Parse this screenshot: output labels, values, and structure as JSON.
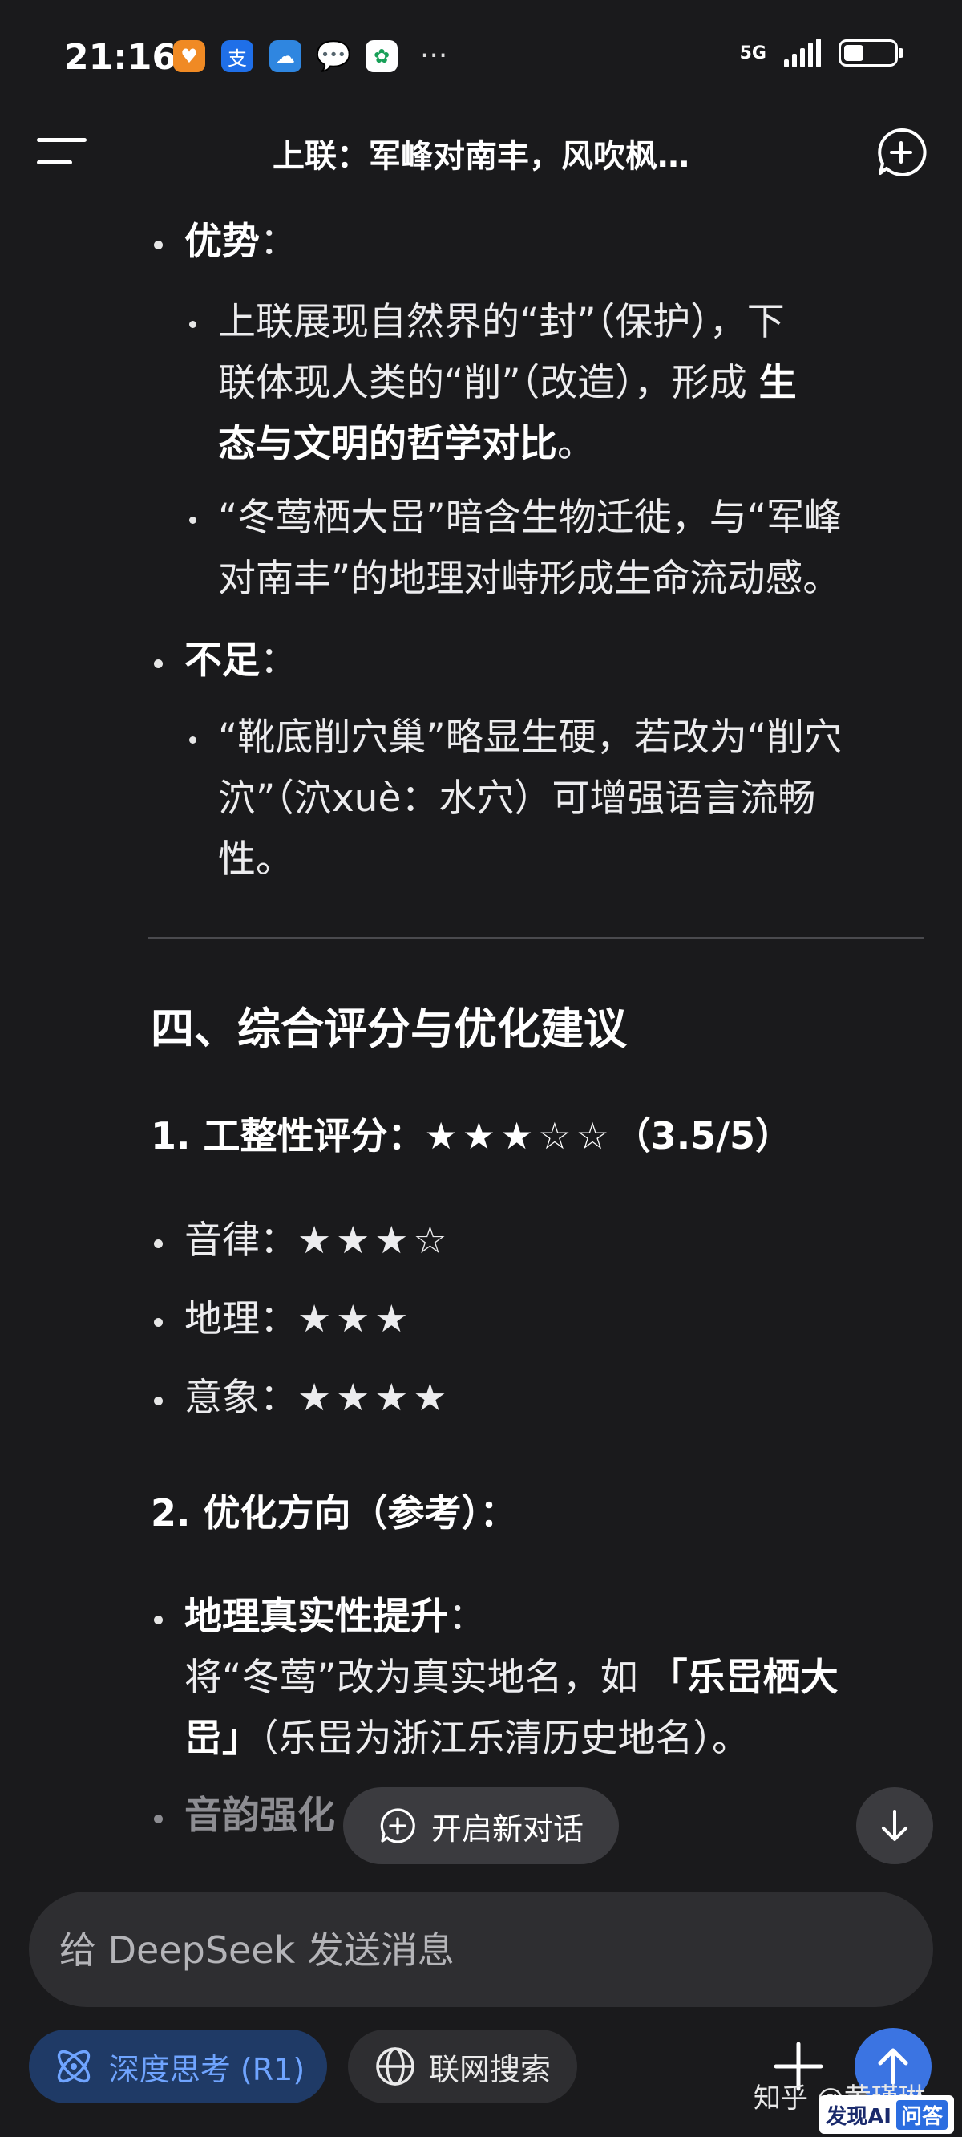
{
  "status_bar": {
    "time": "21:16",
    "network": "5G",
    "more": "···"
  },
  "header": {
    "title": "上联：军峰对南丰，风吹枫…"
  },
  "content": {
    "strengths_label": "优势",
    "strength_1_a": "上联展现自然界的“封”（保护），下",
    "strength_1_b": "联体现人类的“削”（改造），形成 ",
    "strength_1_b_bold": "生",
    "strength_1_c_bold": "态与文明的哲学对比",
    "strength_1_c": "。",
    "strength_2_a": "“冬莺栖大岊”暗含生物迁徙，与“军峰",
    "strength_2_b": "对南丰”的地理对峙形成生命流动感。",
    "weakness_label": "不足",
    "weakness_1_a": "“靴底削穴巢”略显生硬，若改为“削穴",
    "weakness_1_b": "泬”（泬xuè：水穴）可增强语言流畅",
    "weakness_1_c": "性。",
    "section4_title": "四、综合评分与优化建议",
    "score_title": "1. 工整性评分：",
    "score_stars": "★★★☆☆",
    "score_value": "（3.5/5）",
    "rhythm_label": "音律：",
    "rhythm_stars": "★★★☆",
    "geo_label": "地理：",
    "geo_stars": "★★★",
    "imagery_label": "意象：",
    "imagery_stars": "★★★★",
    "opt_title": "2. 优化方向（参考）：",
    "geo_improve_label": "地理真实性提升",
    "geo_improve_a": "将“冬莺”改为真实地名，如 ",
    "geo_improve_a_bold": "「乐岊栖大",
    "geo_improve_b_bold": "岊」",
    "geo_improve_b": "（乐岊为浙江乐清历史地名）。",
    "rhyme_label": "音韵强化",
    "colon": "："
  },
  "new_dialog_label": "开启新对话",
  "input": {
    "placeholder": "给 DeepSeek 发送消息"
  },
  "deep_think_label": "深度思考 (R1)",
  "web_search_label": "联网搜索",
  "watermark": "知乎 @黄瑾琳",
  "badge": {
    "text1": "发现AI",
    "text2": "问答"
  },
  "colors": {
    "background": "#1a1a1c",
    "accent": "#3b74e2",
    "deep_think_bg": "#1f3a66"
  },
  "icons": [
    "menu-icon",
    "new-chat-icon",
    "plus-circle-icon",
    "arrow-down-icon",
    "atom-icon",
    "globe-icon",
    "plus-icon",
    "arrow-up-icon"
  ]
}
